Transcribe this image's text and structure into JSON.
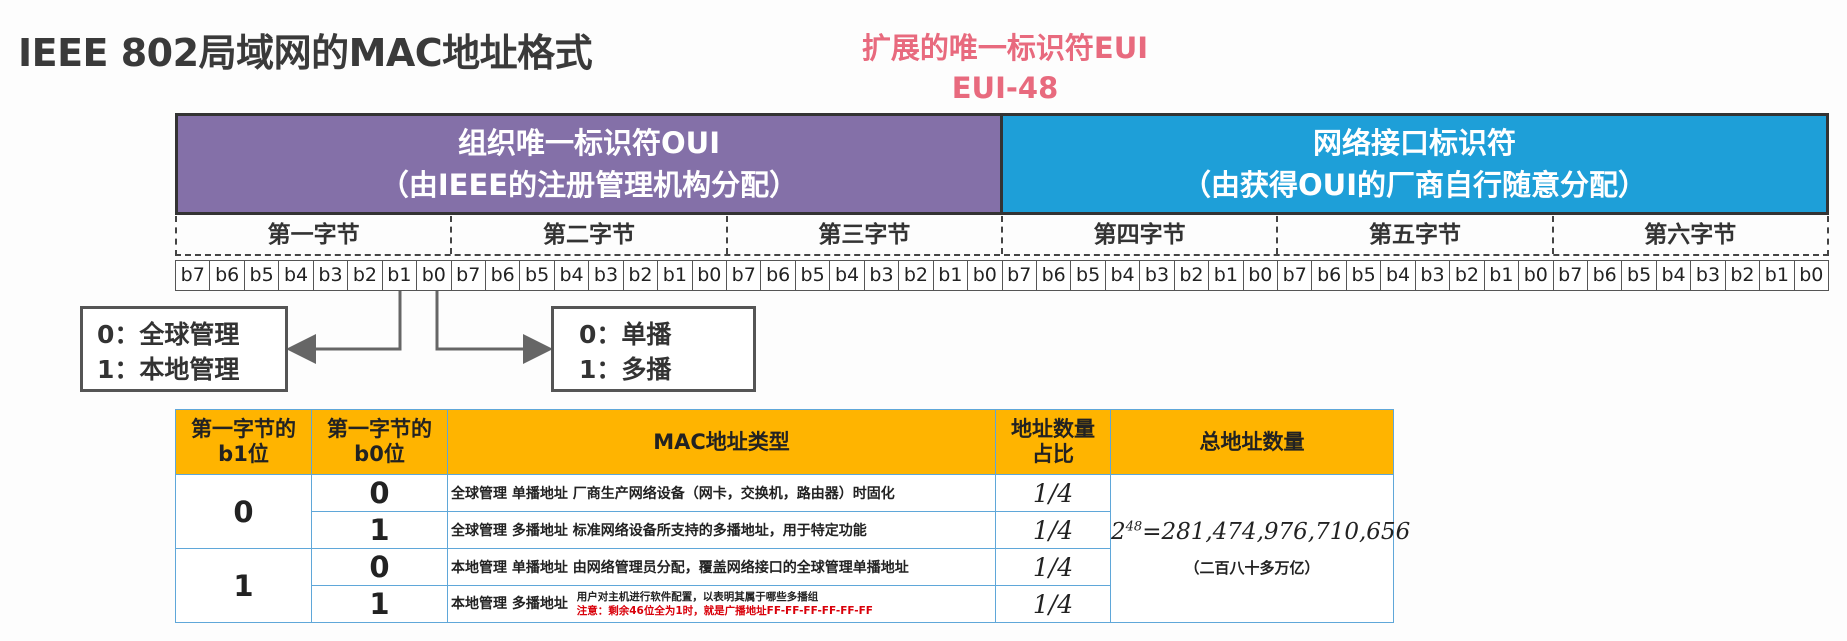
{
  "title": "IEEE 802局域网的MAC地址格式",
  "eui": {
    "line1": "扩展的唯一标识符EUI",
    "line2": "EUI-48",
    "color": "#e86a7e"
  },
  "oui": {
    "line1": "组织唯一标识符OUI",
    "line2": "（由IEEE的注册管理机构分配）",
    "color": "#8470a8"
  },
  "nic": {
    "line1": "网络接口标识符",
    "line2": "（由获得OUI的厂商自行随意分配）",
    "color": "#1e9fd8"
  },
  "bytes": [
    "第一字节",
    "第二字节",
    "第三字节",
    "第四字节",
    "第五字节",
    "第六字节"
  ],
  "bits": [
    "b7",
    "b6",
    "b5",
    "b4",
    "b3",
    "b2",
    "b1",
    "b0"
  ],
  "callout_b1": {
    "line1": "0：全球管理",
    "line2": "1：本地管理"
  },
  "callout_b0": {
    "line1": "0：单播",
    "line2": "1：多播"
  },
  "table": {
    "headers": {
      "b1": "第一字节的b1位",
      "b0": "第一字节的b0位",
      "type": "MAC地址类型",
      "ratio": "地址数量占比",
      "total": "总地址数量"
    },
    "b1_values": [
      "0",
      "1"
    ],
    "rows": [
      {
        "b0": "0",
        "type": "全球管理  单播地址  厂商生产网络设备（网卡，交换机，路由器）时固化",
        "ratio": "1/4"
      },
      {
        "b0": "1",
        "type": "全球管理  多播地址  标准网络设备所支持的多播地址，用于特定功能",
        "ratio": "1/4"
      },
      {
        "b0": "0",
        "type": "本地管理  单播地址  由网络管理员分配，覆盖网络接口的全球管理单播地址",
        "ratio": "1/4"
      },
      {
        "b0": "1",
        "type": "本地管理  多播地址",
        "note": "用户对主机进行软件配置，以表明其属于哪些多播组",
        "note_red": "注意：剩余46位全为1时，就是广播地址FF-FF-FF-FF-FF-FF",
        "ratio": "1/4"
      }
    ],
    "total_base": "2",
    "total_exp": "48",
    "total_value": "=281,474,976,710,656",
    "total_cn": "（二百八十多万亿）",
    "header_color": "#ffb400"
  }
}
